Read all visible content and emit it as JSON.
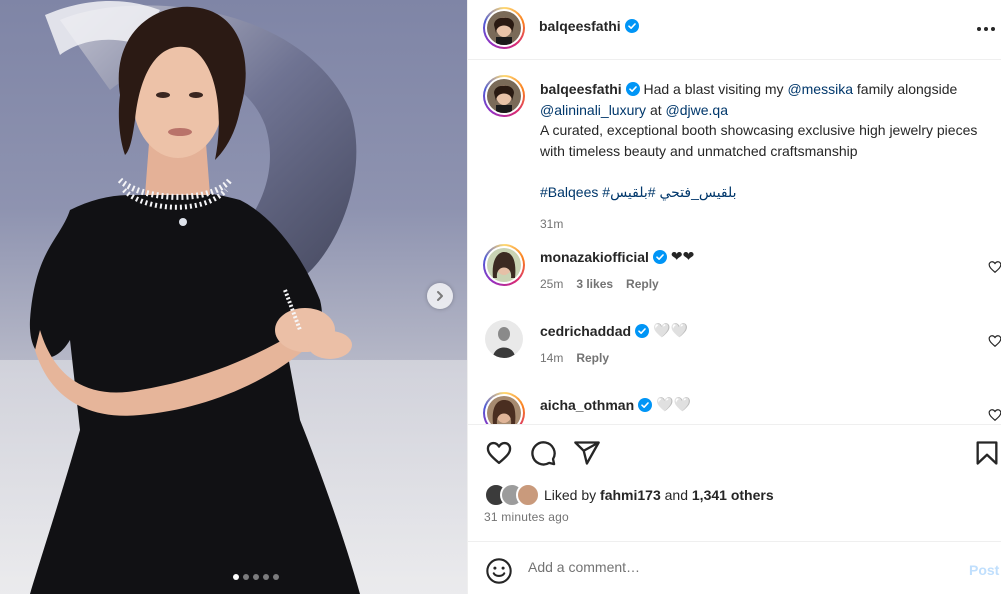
{
  "post": {
    "username": "balqeesfathi",
    "caption": {
      "username": "balqeesfathi",
      "text_1": "Had a blast visiting my",
      "mention_1": "@messika",
      "text_2": "family alongside",
      "mention_2": "@alininali_luxury",
      "text_3": "at",
      "mention_3": "@djwe.qa",
      "text_4": "A curated, exceptional booth showcasing exclusive high jewelry pieces with timeless beauty and unmatched craftsmanship",
      "hashtag_1": "#Balqees",
      "hashtag_2": "#بلقيس_فتحي",
      "hashtag_3": "#بلقيس",
      "time": "31m"
    },
    "comments": [
      {
        "username": "monazakiofficial",
        "text": "❤❤",
        "time": "25m",
        "likes": "3 likes",
        "reply": "Reply"
      },
      {
        "username": "cedrichaddad",
        "text": "🤍🤍",
        "time": "14m",
        "reply": "Reply"
      },
      {
        "username": "aicha_othman",
        "text": "🤍🤍"
      }
    ],
    "liked_by": {
      "prefix": "Liked by",
      "user": "fahmi173",
      "and": "and",
      "others": "1,341 others"
    },
    "time_ago": "31 minutes ago",
    "add_comment": {
      "placeholder": "Add a comment…",
      "post_label": "Post"
    },
    "carousel": {
      "total": 5,
      "current": 1
    },
    "colors": {
      "link": "#00376b",
      "verified": "#0095f6",
      "post_disabled": "#c0dffd"
    },
    "icons": [
      "more-icon",
      "verified-icon",
      "heart-icon",
      "comment-icon",
      "share-icon",
      "bookmark-icon",
      "emoji-icon",
      "chevron-right-icon"
    ]
  }
}
